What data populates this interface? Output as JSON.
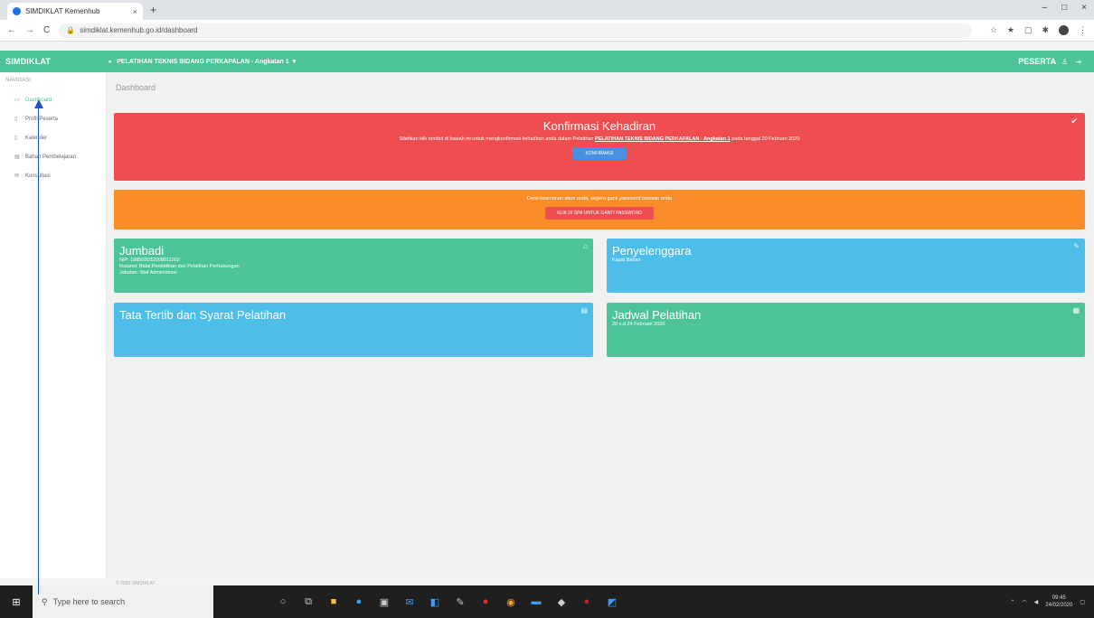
{
  "browser": {
    "tab_title": "SIMDIKLAT Kemenhub",
    "tab_close": "×",
    "newtab": "+",
    "window_controls": [
      "–",
      "□",
      "×"
    ],
    "nav": [
      "←",
      "→",
      "C"
    ],
    "url": "simdiklat.kemenhub.go.id/dashboard",
    "ext_icons": [
      "☆",
      "★",
      "▢",
      "✱"
    ],
    "menu": "⋮"
  },
  "appbar": {
    "brand": "SIMDIKLAT",
    "course": "PELATIHAN TEKNIS BIDANG PERKAPALAN - Angkatan 1",
    "role": "PESERTA"
  },
  "sidebar": {
    "section": "NAVIGASI",
    "items": [
      {
        "label": "Dashboard",
        "icon": "▭"
      },
      {
        "label": "Profil Peserta",
        "icon": "▯"
      },
      {
        "label": "Kalender",
        "icon": "▯"
      },
      {
        "label": "Bahan Pembelajaran",
        "icon": "▤"
      },
      {
        "label": "Konsultasi",
        "icon": "✉"
      }
    ]
  },
  "content": {
    "breadcrumb": "Dashboard",
    "konfirmasi": {
      "title": "Konfirmasi Kehadiran",
      "text": "Silahkan klik tombol di bawah ini untuk mengkonfirmasi kehadiran anda dalam Pelatihan",
      "highlight": "PELATIHAN TEKNIS BIDANG PERKAPALAN - Angkatan 1",
      "text_tail": "pada tanggal 20 Februari 2020",
      "button": "KONFIRMASI"
    },
    "password": {
      "text": "Demi keamanan akun anda, segera ganti password bawaan anda",
      "button": "KLIK DI SINI UNTUK GANTI PASSWORD"
    },
    "profile": {
      "name": "Jumbadi",
      "lines": [
        "NIP: 198503032008011002",
        "Instansi: Balai Pendidikan dan Pelatihan Perhubungan",
        "Jabatan: Staf Administrasi"
      ]
    },
    "penyelenggara": {
      "title": "Penyelenggara",
      "value": "Kapal Bahari"
    },
    "tatatertib": {
      "title": "Tata Tertib dan Syarat Pelatihan"
    },
    "jadwal": {
      "title": "Jadwal Pelatihan",
      "value": "20 s.d 24 Februari 2020"
    },
    "footer": "© 2020 SIMDIKLAT",
    "check_icon": "✔"
  },
  "taskbar": {
    "search_placeholder": "Type here to search",
    "time": "09:45",
    "date": "24/02/2020"
  }
}
